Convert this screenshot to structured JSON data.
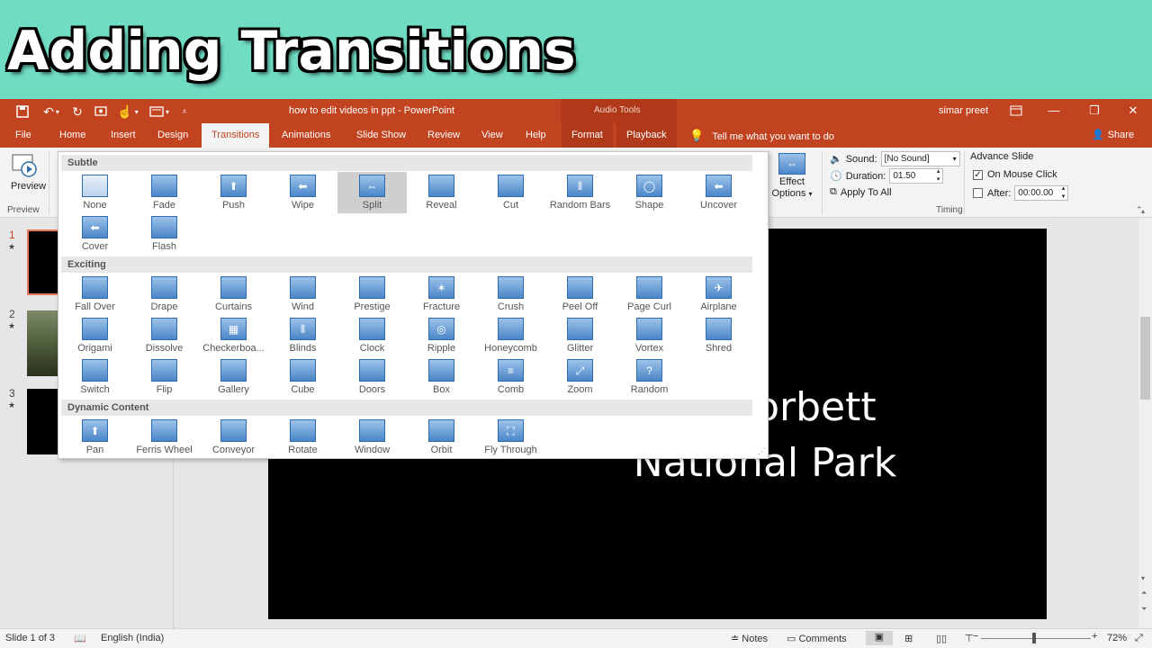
{
  "banner": {
    "title": "Adding Transitions"
  },
  "window": {
    "doc_title": "how to edit videos in ppt  -  PowerPoint",
    "context_group": "Audio Tools",
    "user": "simar preet"
  },
  "tabs": [
    {
      "label": "File"
    },
    {
      "label": "Home"
    },
    {
      "label": "Insert"
    },
    {
      "label": "Design"
    },
    {
      "label": "Transitions"
    },
    {
      "label": "Animations"
    },
    {
      "label": "Slide Show"
    },
    {
      "label": "Review"
    },
    {
      "label": "View"
    },
    {
      "label": "Help"
    },
    {
      "label": "Format"
    },
    {
      "label": "Playback"
    }
  ],
  "tell_me": "Tell me what you want to do",
  "share": "Share",
  "ribbon": {
    "preview_label": "Preview",
    "preview_group": "Preview",
    "effect_options_1": "Effect",
    "effect_options_2": "Options",
    "sound_label": "Sound:",
    "sound_value": "[No Sound]",
    "duration_label": "Duration:",
    "duration_value": "01.50",
    "apply_all": "Apply To All",
    "advance_label": "Advance Slide",
    "on_mouse_click": "On Mouse Click",
    "on_mouse_click_checked": true,
    "after_label": "After:",
    "after_value": "00:00.00",
    "timing_group": "Timing"
  },
  "gallery": {
    "sections": [
      {
        "title": "Subtle",
        "items": [
          "None",
          "Fade",
          "Push",
          "Wipe",
          "Split",
          "Reveal",
          "Cut",
          "Random Bars",
          "Shape",
          "Uncover",
          "Cover",
          "Flash"
        ]
      },
      {
        "title": "Exciting",
        "items": [
          "Fall Over",
          "Drape",
          "Curtains",
          "Wind",
          "Prestige",
          "Fracture",
          "Crush",
          "Peel Off",
          "Page Curl",
          "Airplane",
          "Origami",
          "Dissolve",
          "Checkerboa...",
          "Blinds",
          "Clock",
          "Ripple",
          "Honeycomb",
          "Glitter",
          "Vortex",
          "Shred",
          "Switch",
          "Flip",
          "Gallery",
          "Cube",
          "Doors",
          "Box",
          "Comb",
          "Zoom",
          "Random"
        ]
      },
      {
        "title": "Dynamic Content",
        "items": [
          "Pan",
          "Ferris Wheel",
          "Conveyor",
          "Rotate",
          "Window",
          "Orbit",
          "Fly Through"
        ]
      }
    ],
    "selected": "Split"
  },
  "slides": [
    {
      "num": "1",
      "star": "★"
    },
    {
      "num": "2",
      "star": "★"
    },
    {
      "num": "3",
      "star": "★"
    }
  ],
  "slide": {
    "line1": "Jim Corbett",
    "line2": "National Park"
  },
  "status": {
    "slide_count": "Slide 1 of 3",
    "language": "English (India)",
    "notes": "Notes",
    "comments": "Comments",
    "zoom": "72%"
  }
}
